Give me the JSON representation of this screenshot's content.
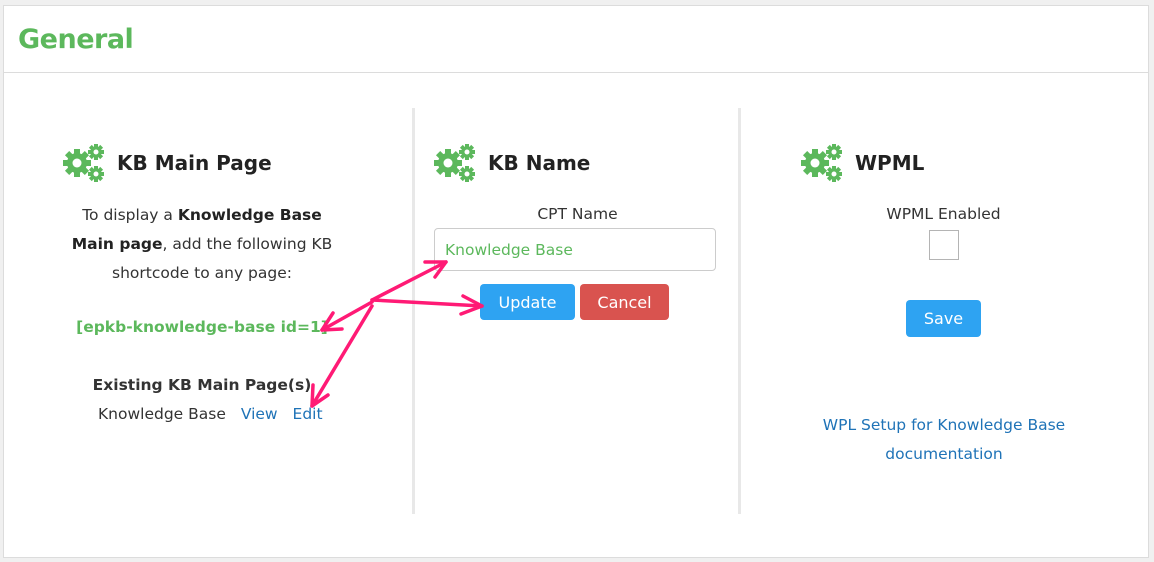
{
  "header": {
    "title": "General"
  },
  "colors": {
    "accent_green": "#5cb85c",
    "primary_blue": "#2ea3f2",
    "danger_red": "#d9534f",
    "link_blue": "#1f73b7",
    "annotation_pink": "#ff1a75"
  },
  "kb_main_page": {
    "icon": "gears-icon",
    "title": "KB Main Page",
    "desc_part1": "To display a ",
    "desc_bold1": "Knowledge Base Main page",
    "desc_part2": ", add the following KB shortcode to any page:",
    "shortcode": "[epkb-knowledge-base id=1]",
    "existing_title": "Existing KB Main Page(s)",
    "existing_page_name": "Knowledge Base",
    "view_label": "View",
    "edit_label": "Edit"
  },
  "kb_name": {
    "icon": "gears-icon",
    "title": "KB Name",
    "cpt_label": "CPT Name",
    "cpt_value": "Knowledge Base",
    "update_label": "Update",
    "cancel_label": "Cancel"
  },
  "wpml": {
    "icon": "gears-icon",
    "title": "WPML",
    "enabled_label": "WPML Enabled",
    "enabled_checked": false,
    "save_label": "Save",
    "doc_link": "WPL Setup for Knowledge Base documentation"
  }
}
